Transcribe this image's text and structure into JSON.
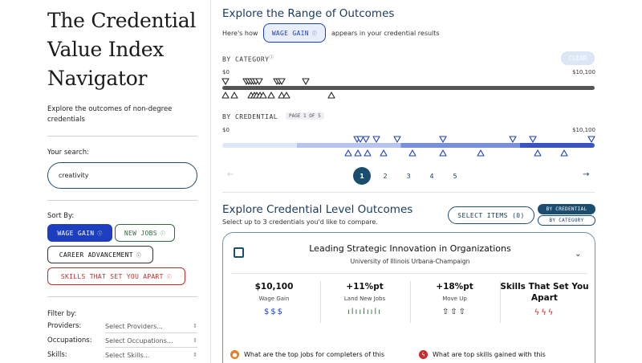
{
  "app": {
    "title": "The Credential Value Index Navigator",
    "intro": "Explore the outcomes of non-degree credentials"
  },
  "search": {
    "label": "Your search:",
    "value": "creativity"
  },
  "sort": {
    "label": "Sort By:",
    "options": [
      "WAGE GAIN",
      "NEW JOBS",
      "CAREER ADVANCEMENT",
      "SKILLS THAT SET YOU APART"
    ],
    "selected": "WAGE GAIN",
    "info_glyph": "ⓘ"
  },
  "filters": {
    "label": "Filter by:",
    "rows": [
      {
        "label": "Providers:",
        "placeholder": "Select Providers..."
      },
      {
        "label": "Occupations:",
        "placeholder": "Select Occupations..."
      },
      {
        "label": "Skills:",
        "placeholder": "Select Skills..."
      }
    ]
  },
  "range_section": {
    "title": "Explore the Range of Outcomes",
    "intro_before": "Here's how",
    "metric_chip": "WAGE GAIN",
    "intro_after": "appears in your credential results",
    "by_category": "BY CATEGORY",
    "clear": "CLEAR",
    "by_credential": "BY CREDENTIAL",
    "page_tag": "PAGE 1 OF 5",
    "min_label": "$0",
    "max_label": "$10,100",
    "category_top_markers": [
      0,
      5.8,
      6.4,
      7.0,
      7.6,
      8.3,
      9.2,
      14.0,
      14.7,
      15.4,
      22.0
    ],
    "category_bottom_markers": [
      0,
      2.5,
      7.0,
      7.8,
      8.6,
      9.4,
      10.4,
      12.6,
      15.4,
      16.6,
      29.0
    ],
    "credential_top_markers": [
      36.0,
      36.8,
      38.3,
      41.2,
      47.0,
      59.4,
      78.6,
      83.9,
      100
    ],
    "credential_bottom_markers": [
      33.6,
      36.2,
      38.8,
      43.3,
      51.1,
      59.4,
      69.8,
      85.3,
      92.6
    ],
    "pages": [
      "1",
      "2",
      "3",
      "4",
      "5"
    ],
    "current_page": "1",
    "prev_arrow": "←",
    "next_arrow": "→"
  },
  "credential_section": {
    "title": "Explore Credential Level Outcomes",
    "subtitle": "Select up to 3 credentials you'd like to compare.",
    "select_button": "SELECT ITEMS (0)",
    "toggle_credential": "BY CREDENTIAL",
    "toggle_category": "BY CATEGORY",
    "card": {
      "title": "Leading Strategic Innovation in Organizations",
      "provider": "University of Illinois Urbana-Champaign",
      "chevron": "⌄",
      "metrics": [
        {
          "value": "$10,100",
          "label": "Wage Gain",
          "icons": "$$$",
          "color": "#1d3fbf"
        },
        {
          "value": "+11%pt",
          "label": "Land New Jobs",
          "icons": "ılıılıılı",
          "color": "#2f6b3a"
        },
        {
          "value": "+18%pt",
          "label": "Move Up",
          "icons": "⇧⇧⇧",
          "color": "#111111"
        },
        {
          "value": "Skills That Set You Apart",
          "label": "",
          "icons": "ϟϟϟ",
          "color": "#c92a2a"
        }
      ]
    },
    "questions": [
      {
        "text": "What are the top jobs for completers of this",
        "color": "#e67e22"
      },
      {
        "text": "What are top skills gained with this",
        "color": "#c92a2a"
      }
    ]
  },
  "colors": {
    "accent_blue": "#1d3fbf",
    "navy": "#1b4d6f",
    "green": "#2f6b3a",
    "red": "#c92a2a"
  }
}
